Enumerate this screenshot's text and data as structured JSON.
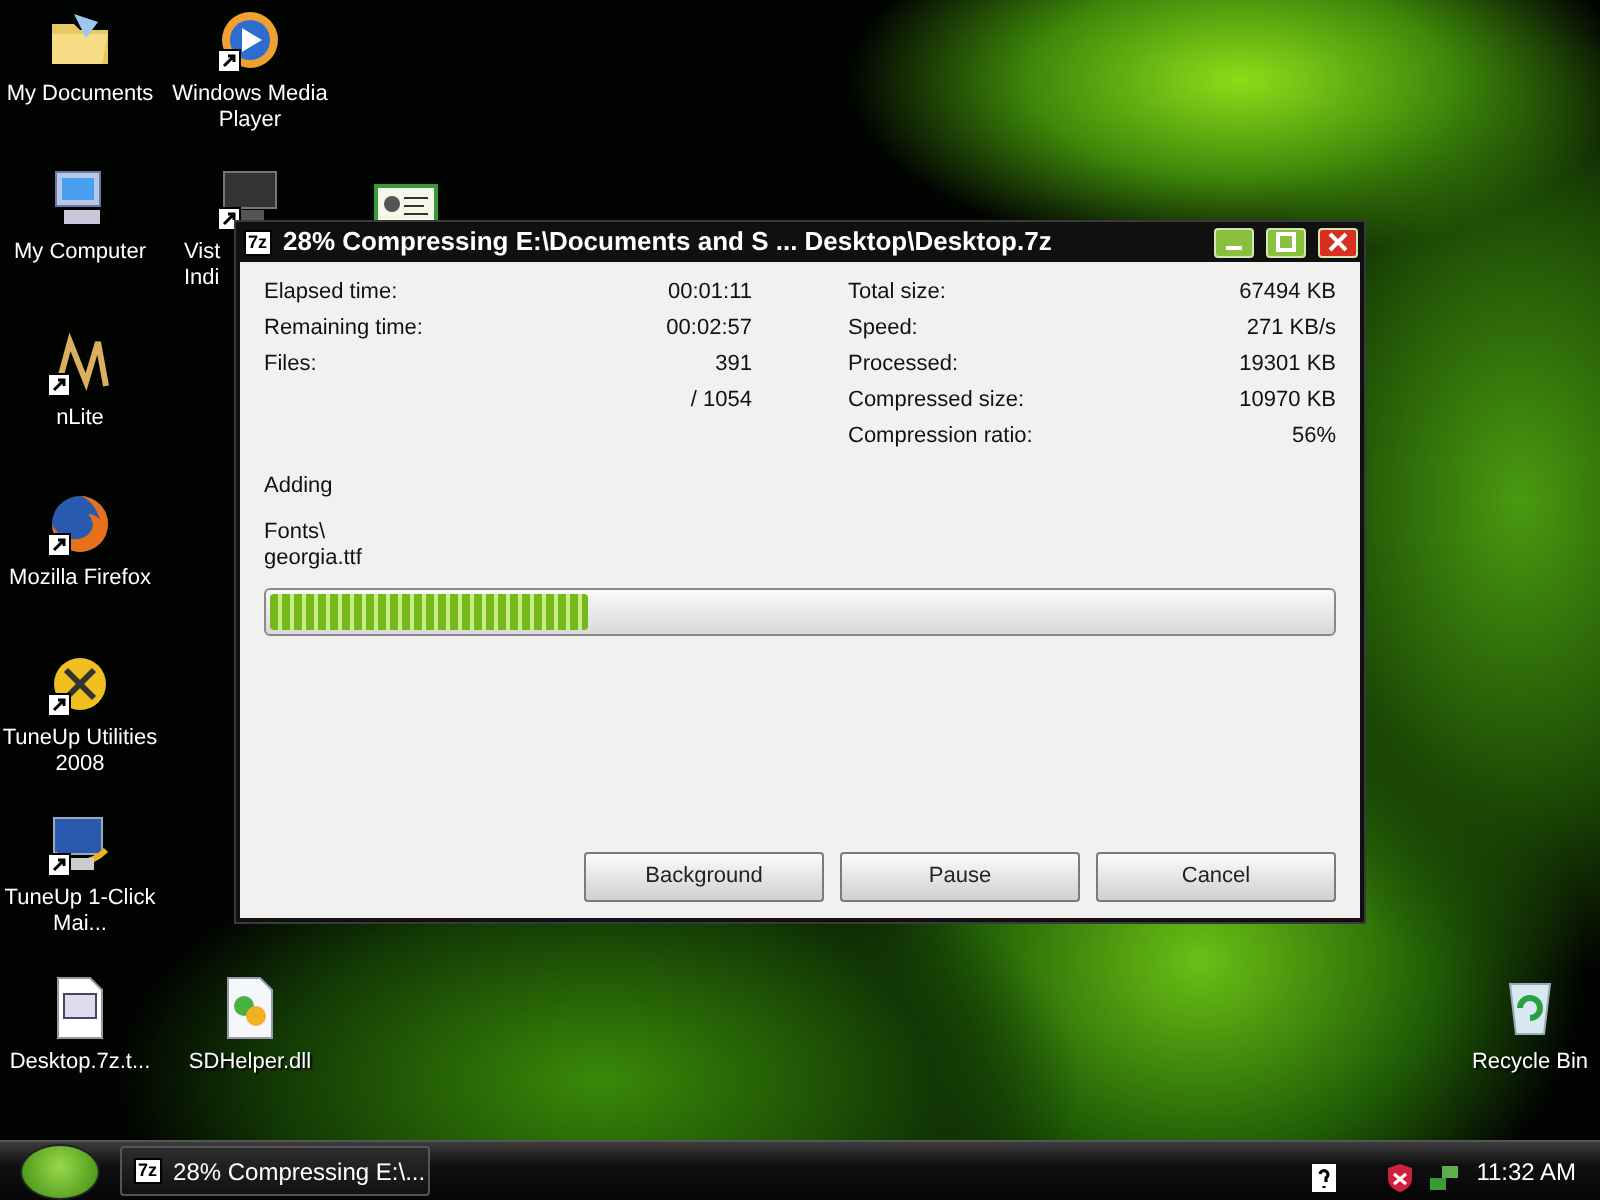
{
  "desktop_icons": [
    {
      "kind": "folder",
      "label": "My Documents",
      "shortcut": false
    },
    {
      "kind": "media",
      "label": "Windows Media Player",
      "shortcut": true
    },
    {
      "kind": "computer",
      "label": "My Computer",
      "shortcut": false
    },
    {
      "kind": "monitor",
      "label": "Vist Indi",
      "shortcut": true
    },
    {
      "kind": "certificate"
    },
    {
      "kind": "nlite",
      "label": "nLite",
      "shortcut": true
    },
    {
      "kind": "firefox",
      "label": "Mozilla Firefox",
      "shortcut": true
    },
    {
      "kind": "tuneup",
      "label": "TuneUp Utilities 2008",
      "shortcut": true
    },
    {
      "kind": "tuneup-click",
      "label": "TuneUp 1-Click Mai...",
      "shortcut": true
    },
    {
      "kind": "file",
      "label": "Desktop.7z.t...",
      "shortcut": false
    },
    {
      "kind": "dll",
      "label": "SDHelper.dll",
      "shortcut": false
    },
    {
      "kind": "recycle",
      "label": "Recycle Bin",
      "shortcut": false
    }
  ],
  "window": {
    "app_icon": "7z",
    "title": "28% Compressing E:\\Documents and S ... Desktop\\Desktop.7z",
    "stats_left": [
      {
        "label": "Elapsed time:",
        "value": "00:01:11"
      },
      {
        "label": "Remaining time:",
        "value": "00:02:57"
      },
      {
        "label": "Files:",
        "value": "391"
      },
      {
        "value": "/ 1054"
      }
    ],
    "stats_right": [
      {
        "label": "Total size:",
        "value": "67494 KB"
      },
      {
        "label": "Speed:",
        "value": "271 KB/s"
      },
      {
        "label": "Processed:",
        "value": "19301 KB"
      },
      {
        "label": "Compressed size:",
        "value": "10970 KB"
      },
      {
        "label": "Compression ratio:",
        "value": "56%"
      }
    ],
    "operation": "Adding",
    "current_lines": [
      "Fonts\\",
      "georgia.ttf"
    ],
    "progress": {
      "level": 0.3
    },
    "buttons": [
      "Background",
      "Pause",
      "Cancel"
    ]
  },
  "taskbar": {
    "tasks": [
      {
        "icon": "7z",
        "label": "28% Compressing E:\\...",
        "selected": false
      }
    ],
    "clock": "11:32 AM"
  }
}
